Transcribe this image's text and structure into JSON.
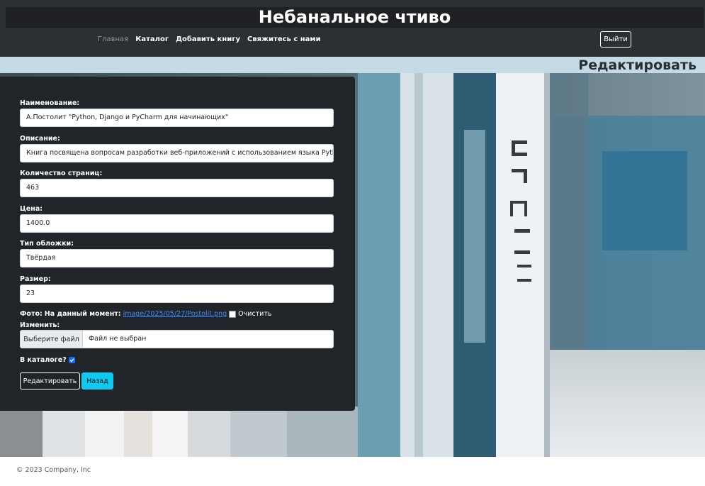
{
  "header": {
    "site_title": "Небанальное чтиво",
    "nav": [
      {
        "label": "Главная"
      },
      {
        "label": "Каталог"
      },
      {
        "label": "Добавить книгу"
      },
      {
        "label": "Свяжитесь с нами"
      }
    ],
    "logout_label": "Выйти"
  },
  "page": {
    "heading": "Редактировать"
  },
  "form": {
    "fields": [
      {
        "label": "Наименование:",
        "value": "А.Постолит \"Python, Django и PyCharm для начинающих\""
      },
      {
        "label": "Описание:",
        "value": "Книга посвящена вопросам разработки веб-приложений с использованием языка Python, фреймворка Django и интерактивной среды разработки PyCharm"
      },
      {
        "label": "Количество страниц:",
        "value": "463"
      },
      {
        "label": "Цена:",
        "value": "1400.0"
      },
      {
        "label": "Тип обложки:",
        "value": "Твёрдая"
      },
      {
        "label": "Размер:",
        "value": "23"
      }
    ],
    "photo": {
      "label": "Фото:",
      "current_text": "На данный момент:",
      "current_link": "image/2025/05/27/Postolit.png",
      "clear_label": "Очистить",
      "change_label": "Изменить:",
      "choose_button": "Выберите файл",
      "file_status": "Файл не выбран"
    },
    "in_catalog_label": "В каталоге?",
    "in_catalog_checked": true,
    "edit_button": "Редактировать",
    "back_button": "Назад"
  },
  "footer": {
    "text": "© 2023 Company, Inc"
  },
  "colors": {
    "navbar": "#2b3035",
    "panel": "#212529",
    "heading_strip": "#c4dbe6",
    "link": "#3d8bfd",
    "back_button": "#0dcaf0",
    "checkbox": "#0d6efd"
  },
  "icons": {
    "catalog_checkbox": "checkmark-icon"
  }
}
